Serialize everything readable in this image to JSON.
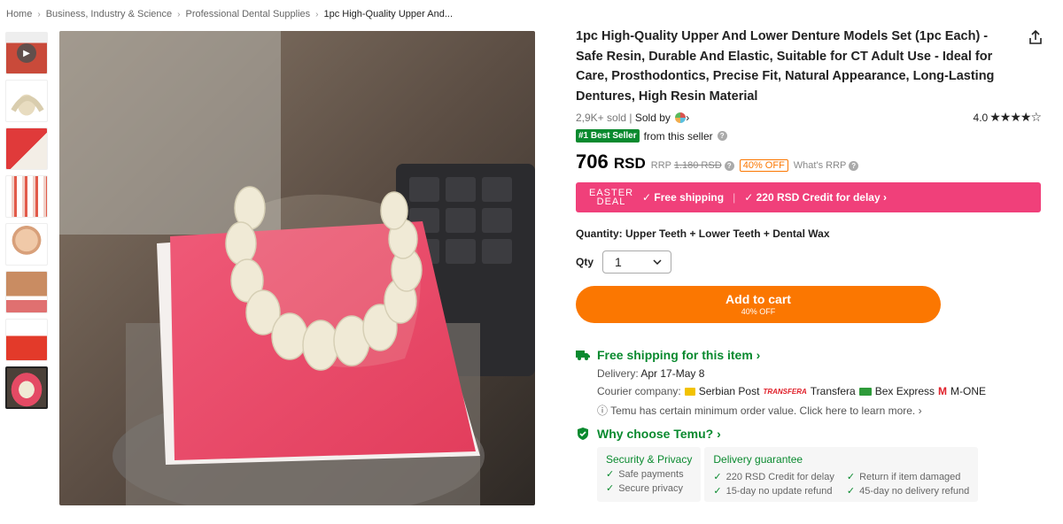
{
  "breadcrumb": [
    "Home",
    "Business, Industry & Science",
    "Professional Dental Supplies",
    "1pc High-Quality Upper And..."
  ],
  "product": {
    "title": "1pc High-Quality Upper And Lower Denture Models Set (1pc Each) - Safe Resin, Durable And Elastic, Suitable for CT Adult Use - Ideal for Care, Prosthodontics, Precise Fit, Natural Appearance, Long-Lasting Dentures, High Resin Material",
    "sold": "2,9K+ sold",
    "sold_by": "Sold by",
    "rating": "4.0",
    "stars": "★★★★☆",
    "best_seller_badge": "#1 Best Seller",
    "best_seller_text": "from this seller"
  },
  "price": {
    "amount": "706",
    "currency": "RSD",
    "rrp_label": "RRP",
    "rrp_value": "1.180 RSD",
    "off": "40% OFF",
    "whats_rrp": "What's RRP"
  },
  "deal": {
    "line1": "EASTER",
    "line2": "DEAL",
    "free_shipping": "✓ Free shipping",
    "credit": "✓ 220 RSD Credit for delay ›"
  },
  "quantity": {
    "label": "Quantity: Upper Teeth + Lower Teeth + Dental Wax",
    "qty_label": "Qty",
    "qty_value": "1"
  },
  "cart": {
    "label": "Add to cart",
    "sub": "40% OFF"
  },
  "shipping": {
    "title": "Free shipping for this item ›",
    "delivery_label": "Delivery:",
    "delivery_value": "Apr 17-May 8",
    "courier_label": "Courier company:",
    "couriers": [
      "Serbian Post",
      "TRANSFERA",
      "Transfera",
      "Bex Express",
      "M-ONE"
    ],
    "notice": "ⓘ Temu has certain minimum order value. Click here to learn more. ›"
  },
  "why": {
    "title": "Why choose Temu? ›",
    "security_title": "Security & Privacy",
    "security_items": [
      "Safe payments",
      "Secure privacy"
    ],
    "delivery_title": "Delivery guarantee",
    "delivery_items": [
      "220 RSD Credit for delay",
      "Return if item damaged",
      "15-day no update refund",
      "45-day no delivery refund"
    ]
  },
  "colors": {
    "accent": "#fb7701",
    "deal": "#f0407a",
    "green": "#0a8a2f"
  }
}
